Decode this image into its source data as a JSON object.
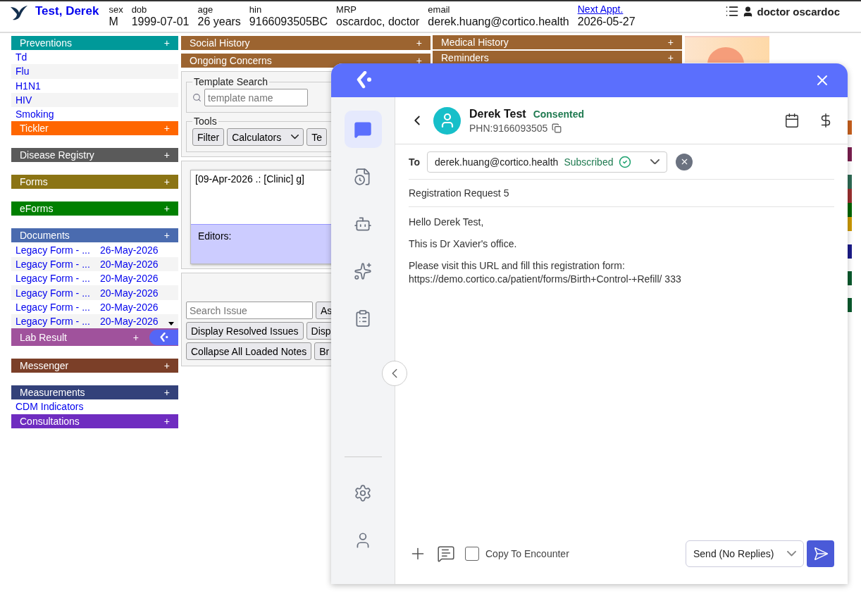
{
  "header": {
    "patient_name": "Test, Derek",
    "fields": [
      {
        "label": "sex",
        "value": "M"
      },
      {
        "label": "dob",
        "value": "1999-07-01"
      },
      {
        "label": "age",
        "value": "26 years"
      },
      {
        "label": "hin",
        "value": "9166093505BC"
      },
      {
        "label": "MRP",
        "value": "oscardoc, doctor"
      },
      {
        "label": "email",
        "value": "derek.huang@cortico.health"
      }
    ],
    "next_appt": {
      "label": "Next Appt.",
      "value": "2026-05-27"
    },
    "user": "doctor oscardoc"
  },
  "left_sections": [
    {
      "title": "Preventions",
      "action": "+",
      "color": "#009999",
      "items": [
        {
          "text": "Td"
        },
        {
          "text": "Flu"
        },
        {
          "text": "H1N1"
        },
        {
          "text": "HIV"
        },
        {
          "text": "Smoking"
        }
      ]
    },
    {
      "title": "Tickler",
      "action": "+",
      "color": "#ff6600"
    },
    {
      "title": "Disease Registry",
      "action": "+",
      "color": "#5a5a5a"
    },
    {
      "title": "Forms",
      "action": "+",
      "color": "#8b7414"
    },
    {
      "title": "eForms",
      "action": "+",
      "color": "#008000"
    },
    {
      "title": "Documents",
      "action": "+",
      "color": "#4a6baf",
      "items": [
        {
          "text": "Legacy Form - ...",
          "date": "26-May-2026"
        },
        {
          "text": "Legacy Form - ...",
          "date": "20-May-2026"
        },
        {
          "text": "Legacy Form - ...",
          "date": "20-May-2026"
        },
        {
          "text": "Legacy Form - ...",
          "date": "20-May-2026"
        },
        {
          "text": "Legacy Form - ...",
          "date": "20-May-2026"
        },
        {
          "text": "Legacy Form - ...",
          "date": "20-May-2026"
        }
      ]
    },
    {
      "title": "Lab Result",
      "action": "+",
      "color": "#a0529c"
    },
    {
      "title": "Messenger",
      "action": "+",
      "color": "#7b3f28"
    },
    {
      "title": "Measurements",
      "action": "+",
      "color": "#33417a",
      "items": [
        {
          "text": "CDM Indicators"
        }
      ]
    },
    {
      "title": "Consultations",
      "action": "+",
      "color": "#6f2cc0"
    }
  ],
  "center_sections": [
    {
      "title": "Social History",
      "action": "+"
    },
    {
      "title": "Ongoing Concerns",
      "action": "+"
    }
  ],
  "right_sections": [
    {
      "title": "Medical History",
      "action": "+"
    },
    {
      "title": "Reminders",
      "action": "+"
    }
  ],
  "template_search": {
    "legend": "Template Search",
    "placeholder": "template name"
  },
  "tools": {
    "legend": "Tools",
    "buttons": [
      "Filter",
      "Te"
    ],
    "select": "Calculators"
  },
  "note": {
    "text": "[09-Apr-2026 .: [Clinic] g]",
    "editors": "Editors:"
  },
  "issues": {
    "placeholder": "Search Issue",
    "buttons": [
      [
        "As"
      ],
      [
        "Display Resolved Issues",
        "Disp"
      ],
      [
        "Collapse All Loaded Notes",
        "Br"
      ]
    ]
  },
  "right_strips": [
    {
      "color": "#c8601e"
    },
    {
      "color": "#7b1f50"
    },
    {
      "color": "#2f6b55"
    },
    {
      "color": "#9a3030"
    },
    {
      "color": "#006600"
    },
    {
      "color": "#cc9900"
    },
    {
      "color": "#1c1c8a"
    },
    {
      "color": "#0b5a2e"
    },
    {
      "color": "#0b5a2e"
    }
  ],
  "messenger": {
    "rail": [
      {
        "kind": "chat",
        "selected": true
      },
      {
        "kind": "history",
        "selected": false
      },
      {
        "kind": "bot",
        "selected": false
      },
      {
        "kind": "ai",
        "selected": false
      },
      {
        "kind": "tasks",
        "selected": false
      }
    ],
    "rail_bottom": [
      {
        "kind": "settings"
      },
      {
        "kind": "profile"
      }
    ],
    "patient": {
      "name": "Derek Test",
      "status": "Consented",
      "phn": "PHN:9166093505"
    },
    "to": {
      "label": "To",
      "email": "derek.huang@cortico.health",
      "status": "Subscribed"
    },
    "subject": "Registration Request 5",
    "body": [
      [
        "Hello Derek Test,"
      ],
      [
        "This is Dr Xavier's office."
      ],
      [
        "Please visit this URL and fill this registration form:",
        "https://demo.cortico.ca/patient/forms/Birth+Control-+Refill/ 333"
      ]
    ],
    "copy_to_encounter": {
      "label": "Copy To Encounter",
      "checked": false
    },
    "send_mode": "Send (No Replies)"
  }
}
